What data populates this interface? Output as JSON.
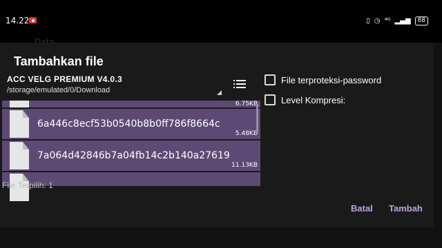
{
  "status_bar": {
    "time": "14.22",
    "battery": "88",
    "record_icon": "screen-record-icon",
    "vibrate_icon": "vibrate-icon",
    "alarm_icon": "alarm-icon",
    "network_text": "⁴ᴳ",
    "signal_icon": "signal-icon"
  },
  "background": {
    "header_fragment": "Data"
  },
  "dialog": {
    "title": "Tambahkan file",
    "folder": {
      "name": "ACC VELG PREMIUM V4.0.3",
      "path": "/storage/emulated/0/Download"
    },
    "files": [
      {
        "name": "",
        "size": "6.75KB"
      },
      {
        "name": "6a446c8ecf53b0540b8b0ff786f8664c",
        "size": "5.48KB"
      },
      {
        "name": "7a064d42846b7a04fb14c2b140a27619",
        "size": "11.13KB"
      }
    ],
    "selected_count": "File Terpilih: 1",
    "options": {
      "password_label": "File terproteksi-password",
      "compression_label": "Level Kompresi:",
      "password_checked": false,
      "compression_checked": false
    },
    "buttons": {
      "cancel": "Batal",
      "add": "Tambah"
    }
  },
  "colors": {
    "accent": "#b9a3e0",
    "selected_row": "#5d4a74"
  }
}
